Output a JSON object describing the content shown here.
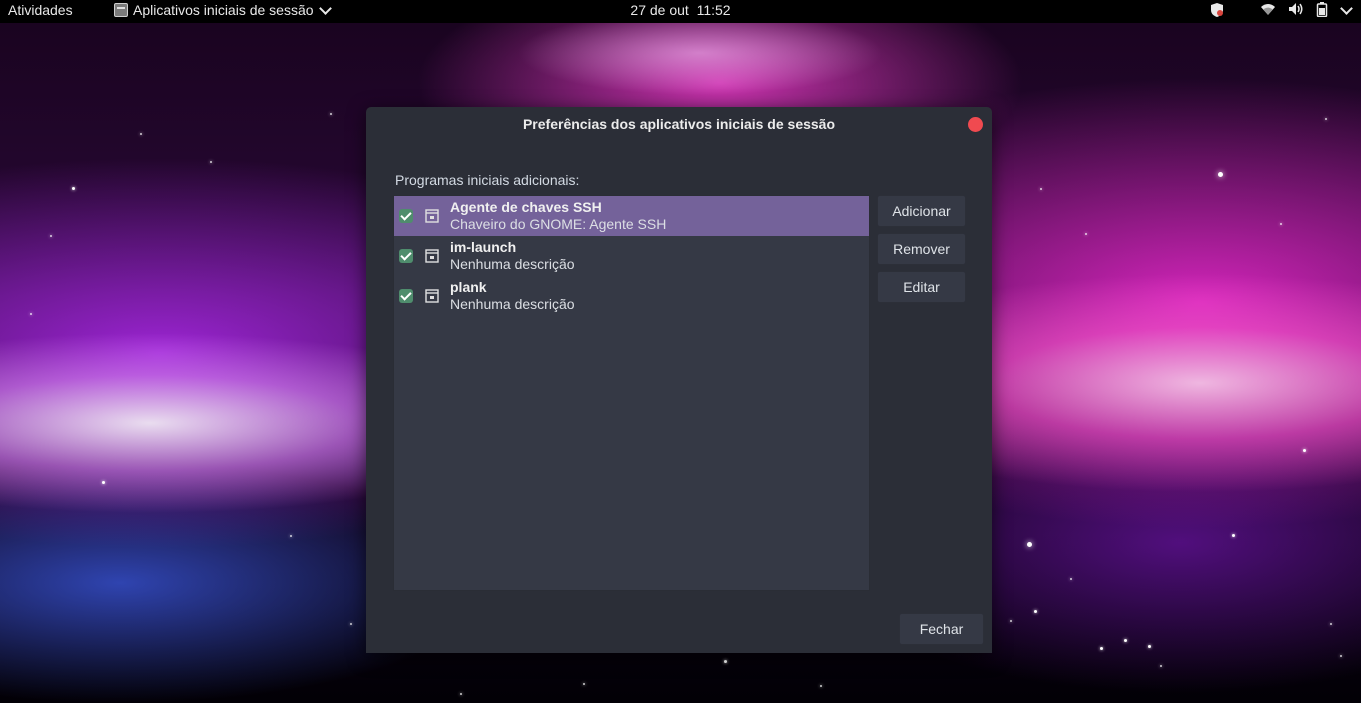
{
  "topbar": {
    "activities": "Atividades",
    "app_menu_label": "Aplicativos iniciais de sessão",
    "date": "27 de out",
    "time": "11:52",
    "tray_icons": [
      "shield-icon",
      "wifi-icon",
      "volume-icon",
      "battery-icon",
      "chevron-down-icon"
    ]
  },
  "dialog": {
    "title": "Preferências dos aplicativos iniciais de sessão",
    "section_label": "Programas iniciais adicionais:",
    "items": [
      {
        "name": "Agente de chaves SSH",
        "description": "Chaveiro do GNOME: Agente SSH",
        "checked": true,
        "selected": true
      },
      {
        "name": "im-launch",
        "description": "Nenhuma descrição",
        "checked": true,
        "selected": false
      },
      {
        "name": "plank",
        "description": "Nenhuma descrição",
        "checked": true,
        "selected": false
      }
    ],
    "buttons": {
      "add": "Adicionar",
      "remove": "Remover",
      "edit": "Editar",
      "close": "Fechar"
    }
  },
  "colors": {
    "accent_selection": "#74629a",
    "close_button": "#f04a50",
    "checkbox": "#4f8d6d",
    "dialog_bg": "#2b2e37"
  }
}
